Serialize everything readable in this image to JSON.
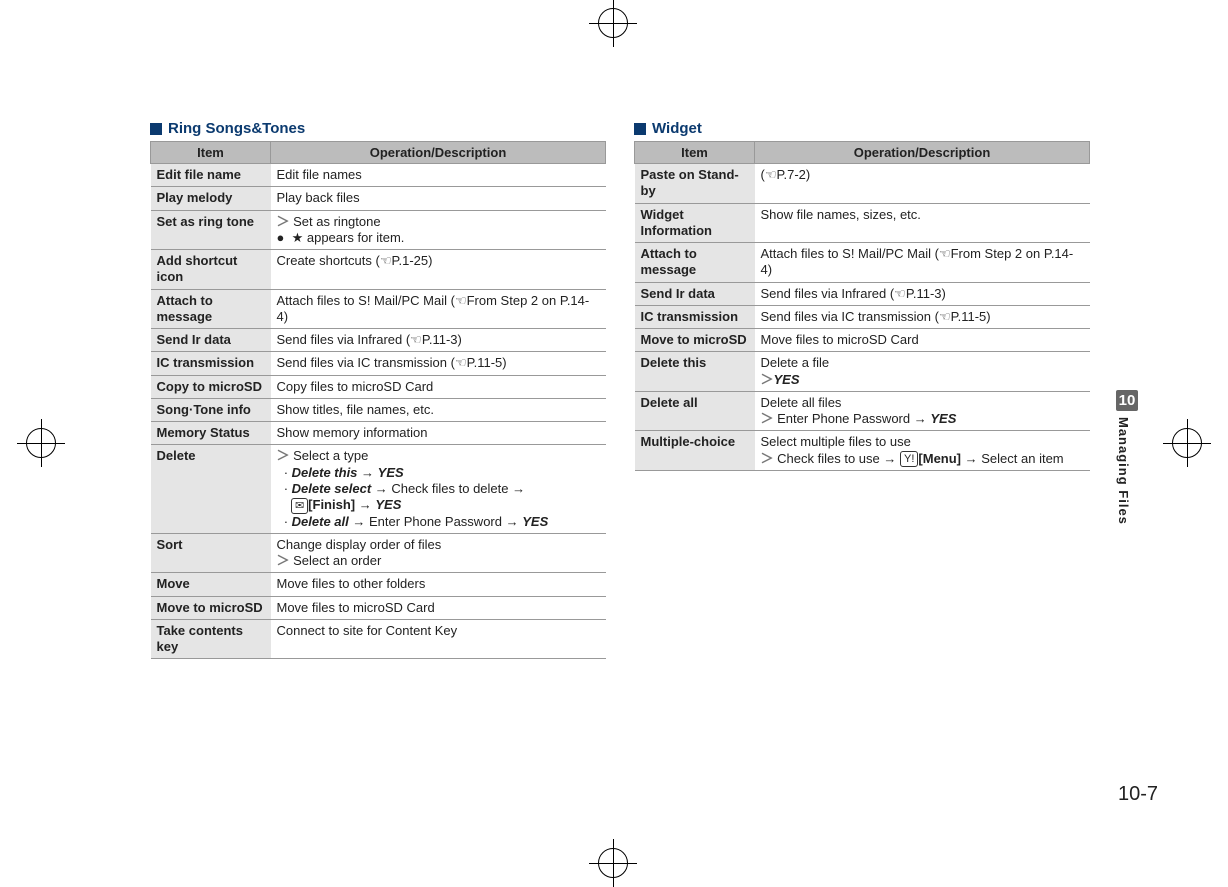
{
  "sections": {
    "ring": {
      "title": "Ring Songs&Tones"
    },
    "widget": {
      "title": "Widget"
    }
  },
  "headers": {
    "item": "Item",
    "op": "Operation/Description"
  },
  "ring_rows": {
    "edit_file_name": {
      "item": "Edit file name",
      "op": "Edit file names"
    },
    "play_melody": {
      "item": "Play melody",
      "op": "Play back files"
    },
    "set_ring": {
      "item": "Set as ring tone",
      "op1": "Set as ringtone",
      "op2": "★ appears for item."
    },
    "add_shortcut": {
      "item": "Add shortcut icon",
      "op_pre": "Create shortcuts (",
      "op_ref": "P.1-25",
      "op_suf": ")"
    },
    "attach_msg": {
      "item": "Attach to message",
      "op_pre": "Attach files to S! Mail/PC Mail (",
      "op_ref": "From Step 2 on P.14-4",
      "op_suf": ")"
    },
    "send_ir": {
      "item": "Send Ir data",
      "op_pre": "Send files via Infrared (",
      "op_ref": "P.11-3",
      "op_suf": ")"
    },
    "ic_trans": {
      "item": "IC transmission",
      "op_pre": "Send files via IC transmission (",
      "op_ref": "P.11-5",
      "op_suf": ")"
    },
    "copy_sd": {
      "item": "Copy to microSD",
      "op": "Copy files to microSD Card"
    },
    "song_info": {
      "item": "Song·Tone info",
      "op": "Show titles, file names, etc."
    },
    "mem_status": {
      "item": "Memory Status",
      "op": "Show memory information"
    },
    "delete": {
      "item": "Delete",
      "op_select": "Select a type",
      "this_lbl": "Delete this",
      "yes": "YES",
      "select_lbl": "Delete select",
      "select_txt": "Check files to delete",
      "finish": "[Finish]",
      "all_lbl": "Delete all",
      "all_txt": "Enter Phone Password"
    },
    "sort": {
      "item": "Sort",
      "op1": "Change display order of files",
      "op2": "Select an order"
    },
    "move": {
      "item": "Move",
      "op": "Move files to other folders"
    },
    "move_sd": {
      "item": "Move to microSD",
      "op": "Move files to microSD Card"
    },
    "take_key": {
      "item": "Take contents key",
      "op": "Connect to site for Content Key"
    }
  },
  "widget_rows": {
    "paste": {
      "item": "Paste on Stand-by",
      "op_pre": "(",
      "op_ref": "P.7-2",
      "op_suf": ")"
    },
    "info": {
      "item": "Widget Information",
      "op": "Show file names, sizes, etc."
    },
    "attach_msg": {
      "item": "Attach to message",
      "op_pre": "Attach files to S! Mail/PC Mail (",
      "op_ref": "From Step 2 on P.14-4",
      "op_suf": ")"
    },
    "send_ir": {
      "item": "Send Ir data",
      "op_pre": "Send files via Infrared (",
      "op_ref": "P.11-3",
      "op_suf": ")"
    },
    "ic_trans": {
      "item": "IC transmission",
      "op_pre": "Send files via IC transmission (",
      "op_ref": "P.11-5",
      "op_suf": ")"
    },
    "move_sd": {
      "item": "Move to microSD",
      "op": "Move files to microSD Card"
    },
    "del_this": {
      "item": "Delete this",
      "op": "Delete a file",
      "yes": "YES"
    },
    "del_all": {
      "item": "Delete all",
      "op": "Delete all files",
      "op2": "Enter Phone Password",
      "yes": "YES"
    },
    "multi": {
      "item": "Multiple-choice",
      "op": "Select multiple files to use",
      "op2": "Check files to use",
      "menu": "[Menu]",
      "op3": "Select an item"
    }
  },
  "side": {
    "chapter": "10",
    "label": "Managing Files"
  },
  "page_number": "10-7"
}
